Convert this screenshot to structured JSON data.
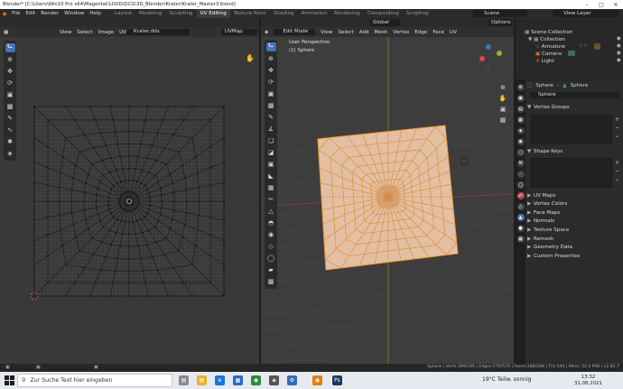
{
  "window": {
    "title": "Blender* [C:\\Users\\Win10 Pro x64\\MagentaCLOUD\\DCG\\3D_Blender\\Krater\\Krater_Master3.blend]"
  },
  "menu": {
    "items": [
      "File",
      "Edit",
      "Render",
      "Window",
      "Help"
    ],
    "workspaces": [
      "Layout",
      "Modeling",
      "Sculpting",
      "UV Editing",
      "Texture Paint",
      "Shading",
      "Animation",
      "Rendering",
      "Compositing",
      "Scripting"
    ],
    "active_workspace": "UV Editing",
    "scene": "Scene",
    "view_layer": "View Layer"
  },
  "uv_editor": {
    "header": [
      "View",
      "Select",
      "Image",
      "UV"
    ],
    "image_name": "Krater.dds",
    "uv_map": "UVMap"
  },
  "viewport": {
    "mode": "Edit Mode",
    "header": [
      "View",
      "Select",
      "Add",
      "Mesh",
      "Vertex",
      "Edge",
      "Face",
      "UV"
    ],
    "orientation": "Global",
    "options": "Options",
    "info_line1": "User Perspective",
    "info_line2": "(1) Sphere"
  },
  "outliner": {
    "collection_root": "Scene Collection",
    "items": [
      "Collection",
      "Armature",
      "Camera",
      "Light"
    ]
  },
  "properties": {
    "breadcrumb": [
      "Sphere",
      "Sphere"
    ],
    "mesh_name": "Sphere",
    "panels": [
      "Vertex Groups",
      "Shape Keys",
      "UV Maps",
      "Vertex Colors",
      "Face Maps",
      "Normals",
      "Texture Space",
      "Remesh",
      "Geometry Data",
      "Custom Properties"
    ]
  },
  "status": {
    "text": "Sphere | Verts:289/289 | Edges:576/576 | Faces:288/288 | Tris:544 | Mem: 52.0 MiB | v2.82.7"
  },
  "taskbar": {
    "search_placeholder": "Zur Suche Text hier eingeben",
    "weather": "19°C  Teilw. sonnig",
    "time": "13:32",
    "date": "31.08.2021"
  },
  "colors": {
    "accent": "#4772b3",
    "orange": "#e87d0d",
    "mesh_face": "#e3c0a4",
    "mesh_edge": "#d9882c"
  }
}
